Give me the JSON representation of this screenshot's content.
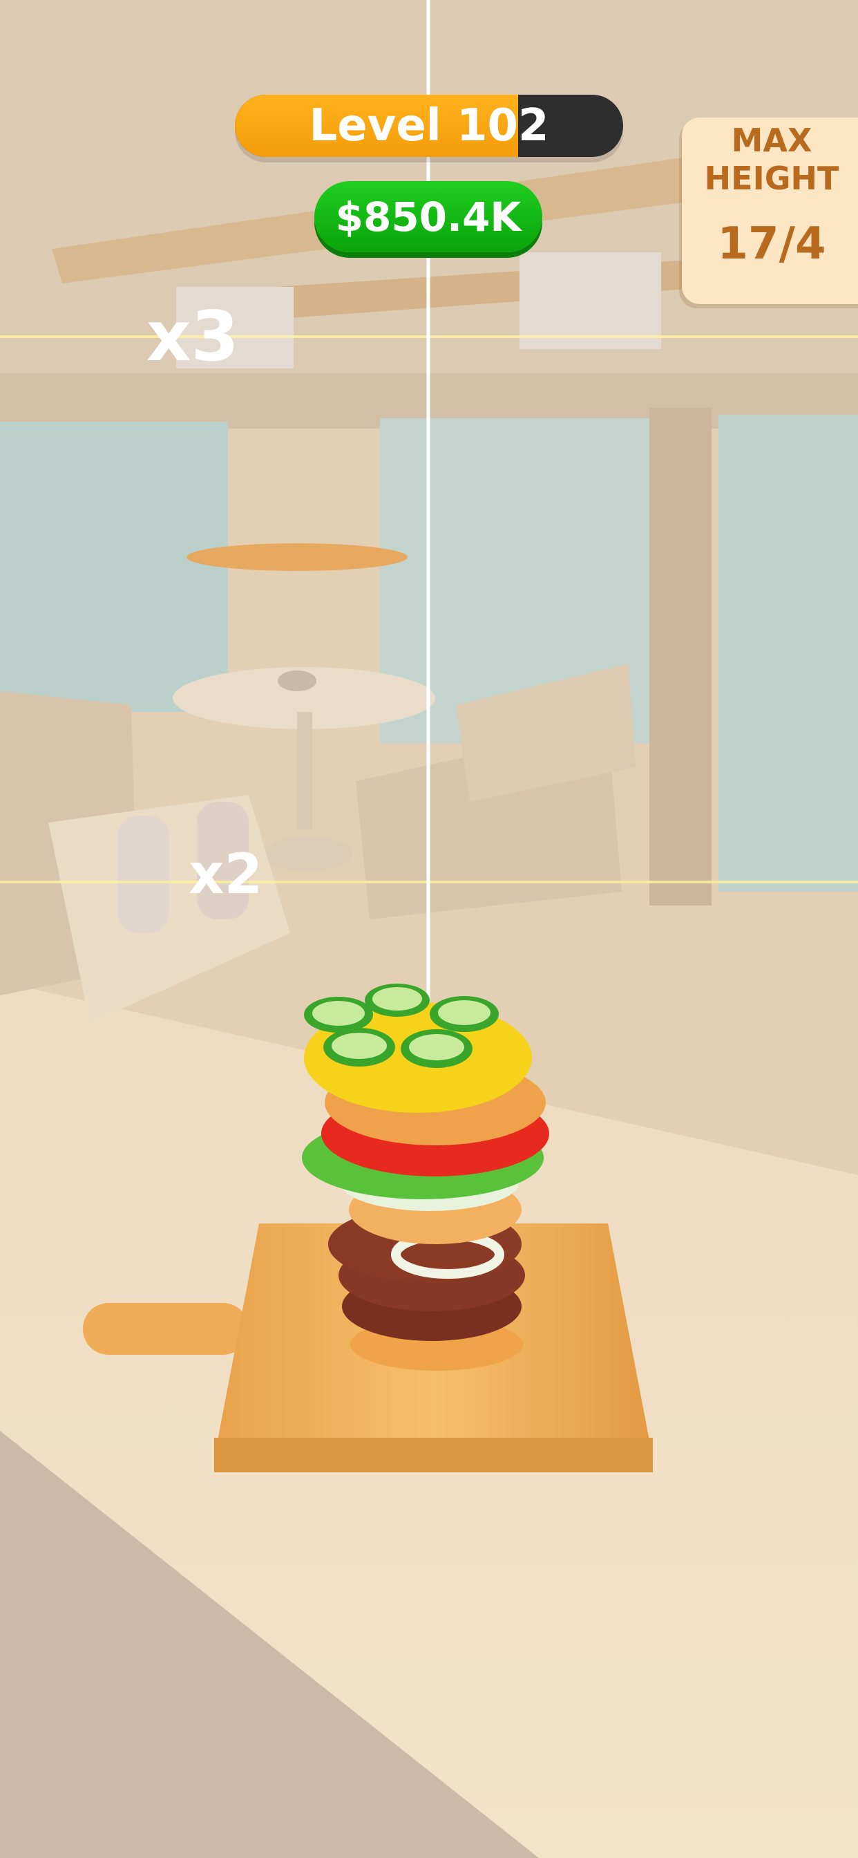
{
  "hud": {
    "level_label": "Level 102",
    "level_progress": 0.73,
    "money": "$850.4K",
    "max_height_title": "MAX\nHEIGHT",
    "max_height_value": "17/4"
  },
  "markers": {
    "x3": "x3",
    "x2": "x2"
  },
  "colors": {
    "level_fill": "#f59c0a",
    "level_track": "#2e2e2e",
    "money_green": "#13b813",
    "panel_bg": "#fde6c4",
    "panel_text": "#b86a1e"
  }
}
